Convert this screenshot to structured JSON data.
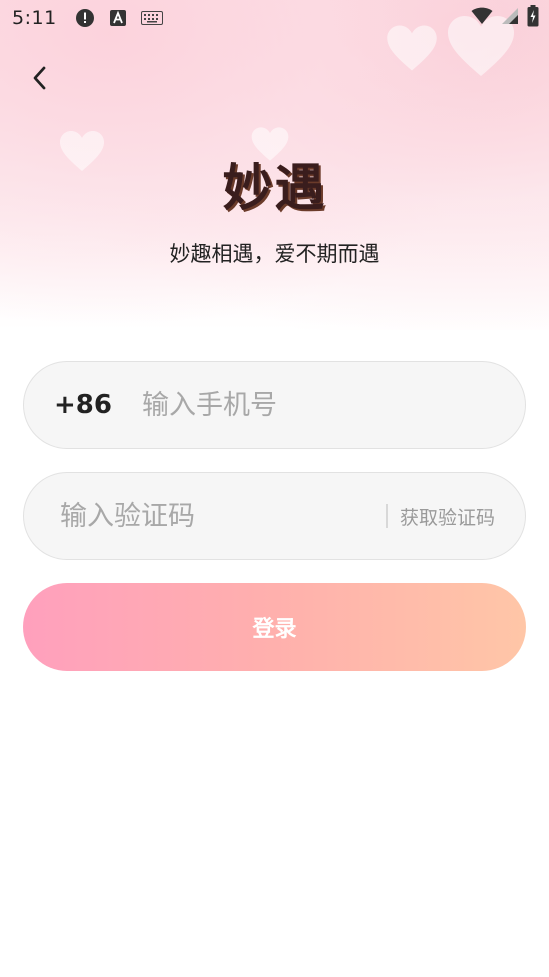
{
  "status_bar": {
    "time": "5:11",
    "icons": [
      "alert-icon",
      "a-box-icon",
      "keyboard-icon",
      "wifi-icon",
      "signal-icon",
      "battery-charging-icon"
    ]
  },
  "header": {
    "back_icon": "chevron-left-icon"
  },
  "brand": {
    "logo_text": "妙遇",
    "tagline": "妙趣相遇，爱不期而遇"
  },
  "form": {
    "country_code": "+86",
    "phone_placeholder": "输入手机号",
    "code_placeholder": "输入验证码",
    "get_code_label": "获取验证码",
    "login_label": "登录"
  },
  "colors": {
    "accent_start": "#ffa0bd",
    "accent_end": "#ffc6a7",
    "input_bg": "#f6f6f6"
  }
}
